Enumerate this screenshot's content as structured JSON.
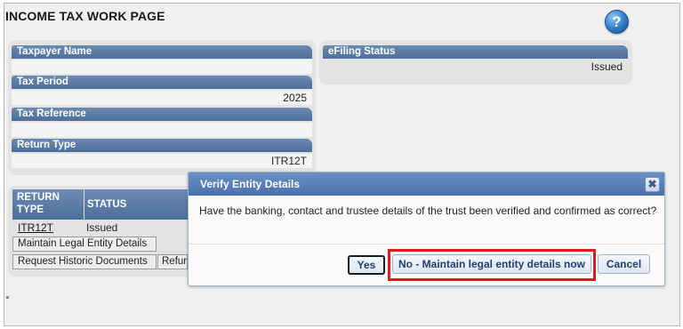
{
  "page": {
    "title": "INCOME TAX WORK PAGE",
    "help_icon": "question-mark",
    "help_glyph": "?"
  },
  "details": {
    "taxpayer_name_label": "Taxpayer Name",
    "taxpayer_name_value": "",
    "tax_period_label": "Tax Period",
    "tax_period_value": "2025",
    "tax_reference_label": "Tax Reference",
    "tax_reference_value": "",
    "return_type_label": "Return Type",
    "return_type_value": "ITR12T"
  },
  "efiling": {
    "label": "eFiling Status",
    "value": "Issued"
  },
  "returns_table": {
    "headers": [
      "RETURN TYPE",
      "STATUS"
    ],
    "header_return_type_line1": "RETURN",
    "header_return_type_line2": "TYPE",
    "rows": [
      {
        "return_type": "ITR12T",
        "status": "Issued"
      }
    ]
  },
  "actions": {
    "maintain_legal_entity": "Maintain Legal Entity Details",
    "request_historic_documents": "Request Historic Documents",
    "refund_partial": "Refur"
  },
  "modal": {
    "title": "Verify Entity Details",
    "close_glyph": "✖",
    "message": "Have the banking, contact and trustee details of the trust been verified and confirmed as correct?",
    "yes_label": "Yes",
    "no_label": "No - Maintain legal entity details now",
    "cancel_label": "Cancel"
  },
  "colors": {
    "header_blue": "#5a7aa5",
    "modal_header_blue": "#5a80b8",
    "highlight_red": "#e01b1b",
    "panel_gray": "#e3e3e3"
  }
}
